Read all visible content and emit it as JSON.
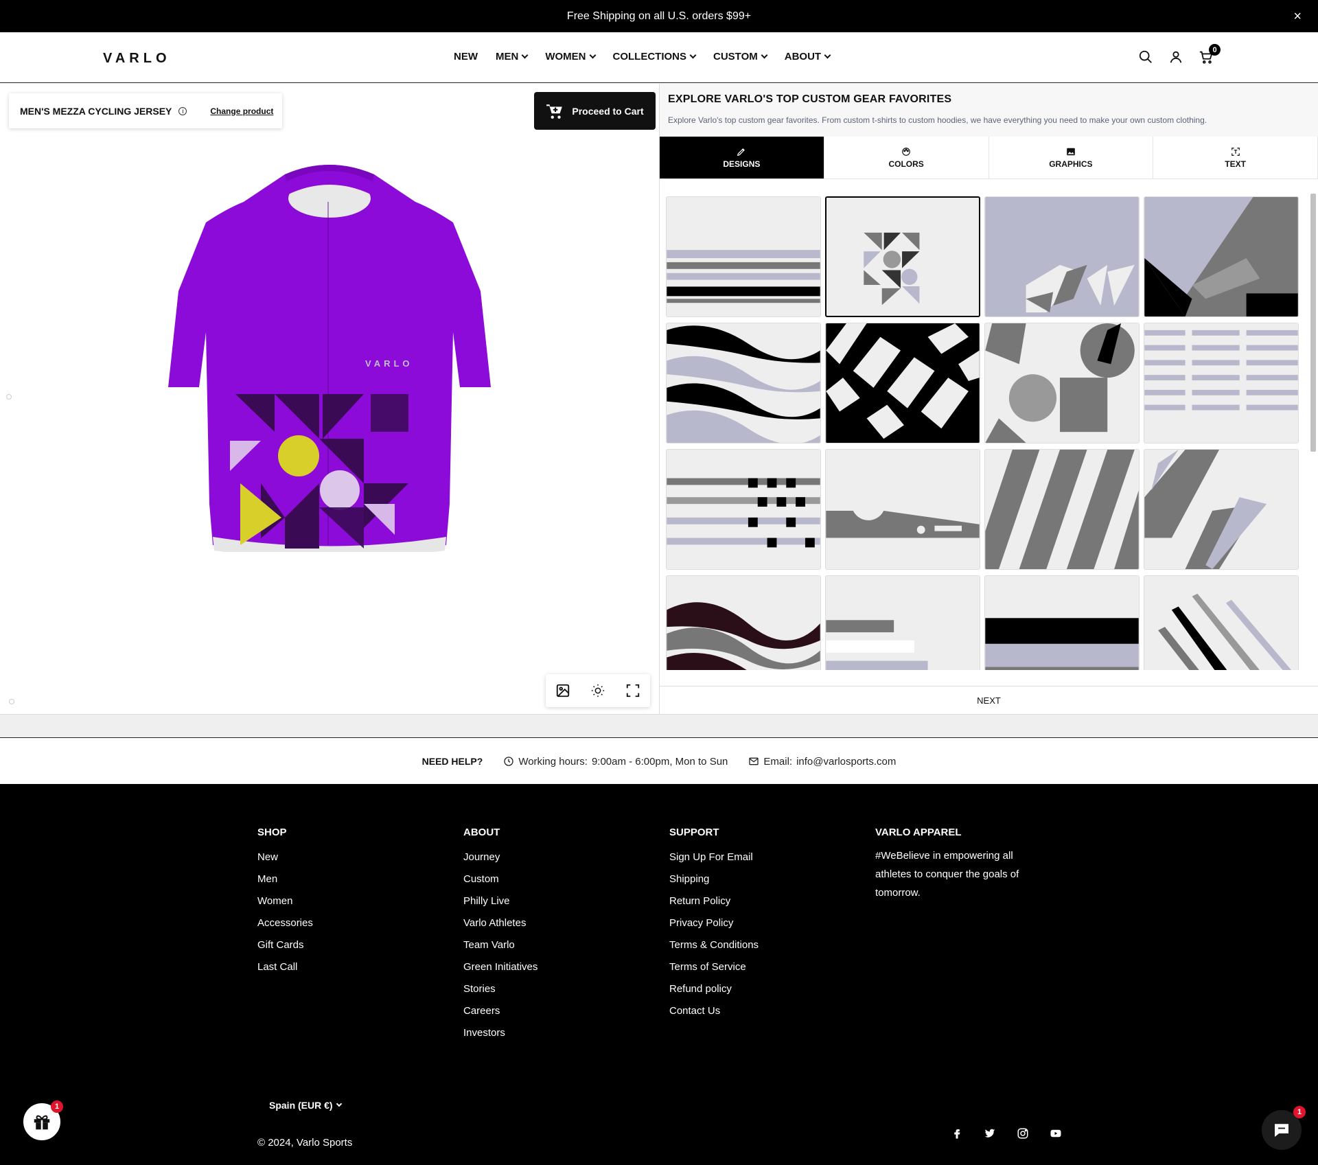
{
  "announcement": {
    "text": "Free Shipping on all U.S. orders $99+",
    "close": "×"
  },
  "header": {
    "logo": "VARLO",
    "nav": [
      "NEW",
      "MEN",
      "WOMEN",
      "COLLECTIONS",
      "CUSTOM",
      "ABOUT"
    ],
    "cart_count": "0"
  },
  "customizer": {
    "product_name": "MEN'S MEZZA CYCLING JERSEY",
    "info": "i",
    "change_product": "Change product",
    "proceed": "Proceed to Cart",
    "jersey_logo": "VARLO",
    "jersey_color": "#8d0bd8",
    "panel_title": "EXPLORE VARLO'S TOP CUSTOM GEAR FAVORITES",
    "panel_subtitle": "Explore Varlo's top custom gear favorites. From custom t-shirts to custom hoodies, we have everything you need to make your own custom clothing.",
    "tabs": [
      "DESIGNS",
      "COLORS",
      "GRAPHICS",
      "TEXT"
    ],
    "active_tab": "DESIGNS",
    "selected_design_index": 1,
    "next": "NEXT"
  },
  "help": {
    "title": "NEED HELP?",
    "hours_label": "Working hours:",
    "hours_value": "9:00am - 6:00pm, Mon to Sun",
    "email_label": "Email:",
    "email_value": "info@varlosports.com"
  },
  "footer": {
    "shop": {
      "title": "SHOP",
      "items": [
        "New",
        "Men",
        "Women",
        "Accessories",
        "Gift Cards",
        "Last Call"
      ]
    },
    "about": {
      "title": "ABOUT",
      "items": [
        "Journey",
        "Custom",
        "Philly Live",
        "Varlo Athletes",
        "Team Varlo",
        "Green Initiatives",
        "Stories",
        "Careers",
        "Investors"
      ]
    },
    "support": {
      "title": "SUPPORT",
      "items": [
        "Sign Up For Email",
        "Shipping",
        "Return Policy",
        "Privacy Policy",
        "Terms & Conditions",
        "Terms of Service",
        "Refund policy",
        "Contact Us"
      ]
    },
    "apparel": {
      "title": "VARLO APPAREL",
      "text": "#WeBelieve in empowering all athletes to conquer the goals of tomorrow."
    },
    "country": "Spain (EUR €)",
    "copyright": "© 2024, Varlo Sports",
    "socials": [
      "facebook-icon",
      "twitter-icon",
      "instagram-icon",
      "youtube-icon"
    ]
  },
  "widgets": {
    "gift_badge": "1",
    "chat_badge": "1"
  },
  "colors": {
    "accent_purple": "#8d0bd8",
    "lavender": "#b8b8cc",
    "yellow": "#d9cf2a"
  }
}
